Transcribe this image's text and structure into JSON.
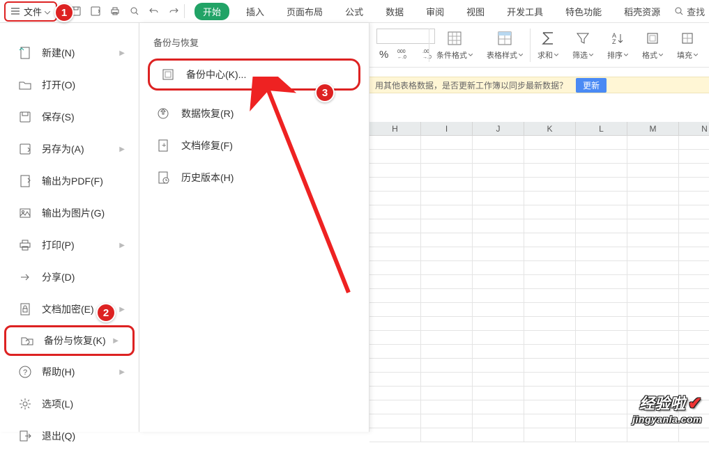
{
  "toolbar": {
    "file_label": "文件",
    "tabs": [
      "开始",
      "插入",
      "页面布局",
      "公式",
      "数据",
      "审阅",
      "视图",
      "开发工具",
      "特色功能",
      "稻壳资源"
    ],
    "find_label": "查找"
  },
  "ribbon": {
    "percent": "%",
    "dec_inc": "000 .00",
    "dec_dec": ".00 .0",
    "cond_fmt": "条件格式",
    "table_style": "表格样式",
    "sum": "求和",
    "filter": "筛选",
    "sort": "排序",
    "format": "格式",
    "fill": "填充"
  },
  "notify": {
    "text": "用其他表格数据，是否更新工作簿以同步最新数据？",
    "button": "更新"
  },
  "columns": [
    "H",
    "I",
    "J",
    "K",
    "L",
    "M",
    "N"
  ],
  "file_menu": [
    {
      "label": "新建(N)",
      "icon": "new",
      "arrow": true
    },
    {
      "label": "打开(O)",
      "icon": "open",
      "arrow": false
    },
    {
      "label": "保存(S)",
      "icon": "save",
      "arrow": false
    },
    {
      "label": "另存为(A)",
      "icon": "saveas",
      "arrow": true
    },
    {
      "label": "输出为PDF(F)",
      "icon": "pdf",
      "arrow": false
    },
    {
      "label": "输出为图片(G)",
      "icon": "image",
      "arrow": false
    },
    {
      "label": "打印(P)",
      "icon": "print",
      "arrow": true
    },
    {
      "label": "分享(D)",
      "icon": "share",
      "arrow": false
    },
    {
      "label": "文档加密(E)",
      "icon": "lock",
      "arrow": true
    },
    {
      "label": "备份与恢复(K)",
      "icon": "backup",
      "arrow": true,
      "highlight": true
    },
    {
      "label": "帮助(H)",
      "icon": "help",
      "arrow": true
    },
    {
      "label": "选项(L)",
      "icon": "options",
      "arrow": false
    },
    {
      "label": "退出(Q)",
      "icon": "exit",
      "arrow": false
    }
  ],
  "submenu": {
    "title": "备份与恢复",
    "items": [
      {
        "label": "备份中心(K)...",
        "icon": "backup-center",
        "highlight": true
      },
      {
        "label": "数据恢复(R)",
        "icon": "recover"
      },
      {
        "label": "文档修复(F)",
        "icon": "repair"
      },
      {
        "label": "历史版本(H)",
        "icon": "history"
      }
    ]
  },
  "callouts": {
    "c1": "1",
    "c2": "2",
    "c3": "3"
  },
  "watermark": {
    "top": "经验啦",
    "bottom": "jingyanla.com"
  }
}
